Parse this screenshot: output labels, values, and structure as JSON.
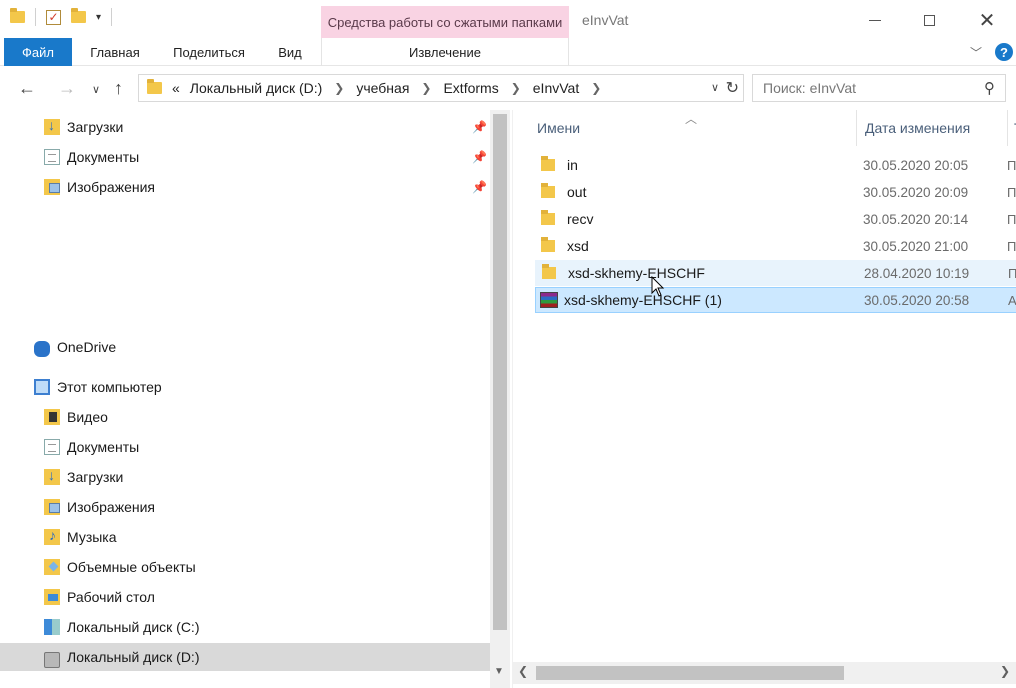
{
  "titlebar": {
    "title": "eInvVat",
    "context_tab": "Средства работы со сжатыми папками"
  },
  "ribbon": {
    "tabs": [
      "Файл",
      "Главная",
      "Поделиться",
      "Вид",
      "Извлечение"
    ],
    "help": "?"
  },
  "navigation": {
    "back": "←",
    "forward": "→",
    "up": "↑",
    "breadcrumb": [
      "Локальный диск (D:)",
      "учебная",
      "Extforms",
      "eInvVat"
    ],
    "overflow": "«",
    "search_placeholder": "Поиск: eInvVat"
  },
  "tree": {
    "quick_access": [
      {
        "label": "Загрузки",
        "icon": "downloads-icon"
      },
      {
        "label": "Документы",
        "icon": "documents-icon"
      },
      {
        "label": "Изображения",
        "icon": "pictures-icon"
      }
    ],
    "onedrive": "OneDrive",
    "this_pc": "Этот компьютер",
    "pc_items": [
      {
        "label": "Видео",
        "icon": "video-icon"
      },
      {
        "label": "Документы",
        "icon": "documents-icon"
      },
      {
        "label": "Загрузки",
        "icon": "downloads-icon"
      },
      {
        "label": "Изображения",
        "icon": "pictures-icon"
      },
      {
        "label": "Музыка",
        "icon": "music-icon"
      },
      {
        "label": "Объемные объекты",
        "icon": "3d-objects-icon"
      },
      {
        "label": "Рабочий стол",
        "icon": "desktop-icon"
      },
      {
        "label": "Локальный диск (C:)",
        "icon": "drive-c-icon"
      },
      {
        "label": "Локальный диск (D:)",
        "icon": "drive-d-icon",
        "selected": true
      }
    ]
  },
  "content": {
    "columns": {
      "name": "Имени",
      "date": "Дата изменения",
      "type": "Т"
    },
    "files": [
      {
        "name": "in",
        "date": "30.05.2020 20:05",
        "type": "П",
        "icon": "folder-icon"
      },
      {
        "name": "out",
        "date": "30.05.2020 20:09",
        "type": "П",
        "icon": "folder-icon"
      },
      {
        "name": "recv",
        "date": "30.05.2020 20:14",
        "type": "П",
        "icon": "folder-icon"
      },
      {
        "name": "xsd",
        "date": "30.05.2020 21:00",
        "type": "П",
        "icon": "folder-icon"
      },
      {
        "name": "xsd-skhemy-EHSCHF",
        "date": "28.04.2020 10:19",
        "type": "П",
        "icon": "folder-icon",
        "state": "hover"
      },
      {
        "name": "xsd-skhemy-EHSCHF (1)",
        "date": "30.05.2020 20:58",
        "type": "A",
        "icon": "rar-archive-icon",
        "state": "selected"
      }
    ]
  },
  "colors": {
    "accent": "#1979ca",
    "context_tab": "#f9d3e3",
    "row_selected": "#cce8ff",
    "row_hover": "#e8f3fc"
  }
}
